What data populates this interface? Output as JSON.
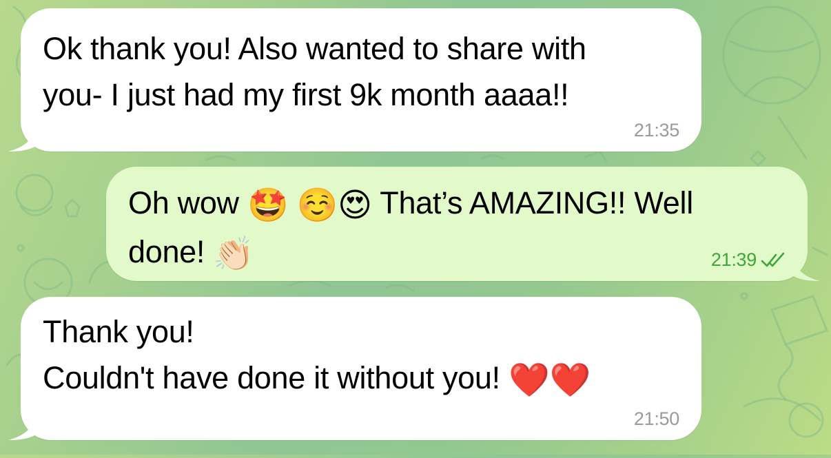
{
  "messages": [
    {
      "direction": "incoming",
      "lines": [
        "Ok thank you! Also wanted to share with",
        "you- I just had my first 9k month aaaa!!"
      ],
      "time": "21:35"
    },
    {
      "direction": "outgoing",
      "line1": {
        "before": "Oh wow",
        "emojis": [
          "🤩",
          "☺️",
          "😍"
        ],
        "after": "That’s AMAZING!! Well"
      },
      "line2": {
        "text": "done!",
        "emoji": "👏🏻"
      },
      "time": "21:39",
      "status_icon": "double-check-icon"
    },
    {
      "direction": "incoming",
      "lines": [
        "Thank you!",
        "Couldn't have done it without you!"
      ],
      "line2_emojis": [
        "❤️",
        "❤️"
      ],
      "time": "21:50"
    }
  ],
  "colors": {
    "incoming_bubble": "#ffffff",
    "outgoing_bubble": "#e2f9c9",
    "outgoing_time": "#3fa63b",
    "incoming_time": "#9a9a9a"
  }
}
